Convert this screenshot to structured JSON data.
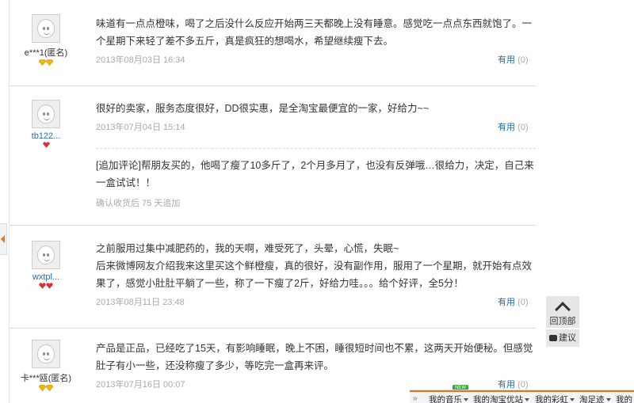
{
  "reviews": [
    {
      "username": "e***1(匿名)",
      "text": "味道有一点点橙味，喝了之后没什么反应开始两三天都晚上没有睡意。感觉吃一点点东西就饱了。一个星期下来轻了差不多五斤，真是疯狂的想喝水，希望继续瘦下去。",
      "date": "2013年08月03日 16:34",
      "useful_label": "有用",
      "useful_count": "(0)"
    },
    {
      "username": "tb122...",
      "text": "很好的卖家，服务态度很好，DD很实惠，是全淘宝最便宜的一家，好给力~~",
      "date": "2013年07月04日 15:14",
      "useful_label": "有用",
      "useful_count": "(0)",
      "append_text": "[追加评论]帮朋友买的，他喝了瘦了10多斤了，2个月多月了，也没有反弹哦…很给力，决定，自己来一盒试试！！",
      "append_meta": "确认收货后 75 天追加"
    },
    {
      "username": "wxtpl...",
      "text": "之前服用过集中减肥药的，我的天啊，难受死了，头晕，心慌，失眠~",
      "text2": "后来微博网友介绍我来这里买这个鲜橙瘦，真的很好，没有副作用，服用了一个星期，就开始有点效果了，感觉小肚肚平躺了一些，称了一下瘦了2斤，好给力哇。。。给个好评，全5分！",
      "date": "2013年08月11日 23:48",
      "useful_label": "有用",
      "useful_count": "(0)"
    },
    {
      "username": "卡***瓯(匿名)",
      "text": "产品是正品，已经吃了15天，有影响睡眠，晚上不困，睡很短时间也不累，这两天开始便秘。但感觉肚子有小一些，还没称瘦了多少，等吃完一盒再来评。",
      "date": "2013年07月16日 00:07",
      "useful_label": "有用",
      "useful_count": "(0)"
    }
  ],
  "floating": {
    "back_to_top": "回顶部",
    "suggest": "建议"
  },
  "bottom_bar": {
    "new_badge": "NEW",
    "items": [
      "我的音乐",
      "我的淘宝优站",
      "我的彩虹",
      "淘足迹",
      "我的"
    ]
  },
  "colors": {
    "link": "#2b6aa8",
    "muted": "#aaaaaa",
    "accent": "#e4741a",
    "gem_gold": "#f2b705",
    "gem_red": "#d8323a"
  }
}
